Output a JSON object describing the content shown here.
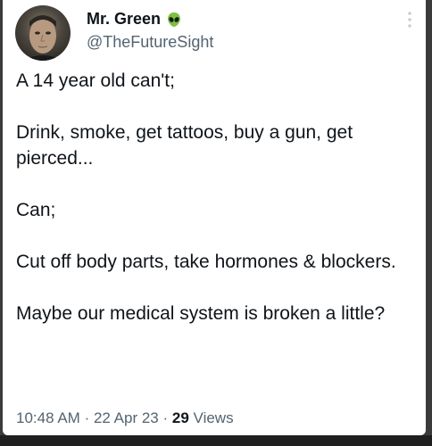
{
  "author": {
    "display_name": "Mr. Green",
    "handle": "@TheFutureSight",
    "badge_icon": "alien-emoji-icon"
  },
  "tweet": {
    "paragraphs": [
      "A 14 year old can't;",
      "Drink, smoke, get tattoos, buy a gun, get pierced...",
      "Can;",
      "Cut off body parts, take hormones & blockers.",
      "Maybe our medical system is broken a little?"
    ]
  },
  "meta": {
    "time": "10:48 AM",
    "separator": "·",
    "date": "22 Apr 23",
    "views_count": "29",
    "views_label": "Views"
  },
  "colors": {
    "text": "#0f1419",
    "secondary": "#536471",
    "alien_green": "#7cc142"
  }
}
